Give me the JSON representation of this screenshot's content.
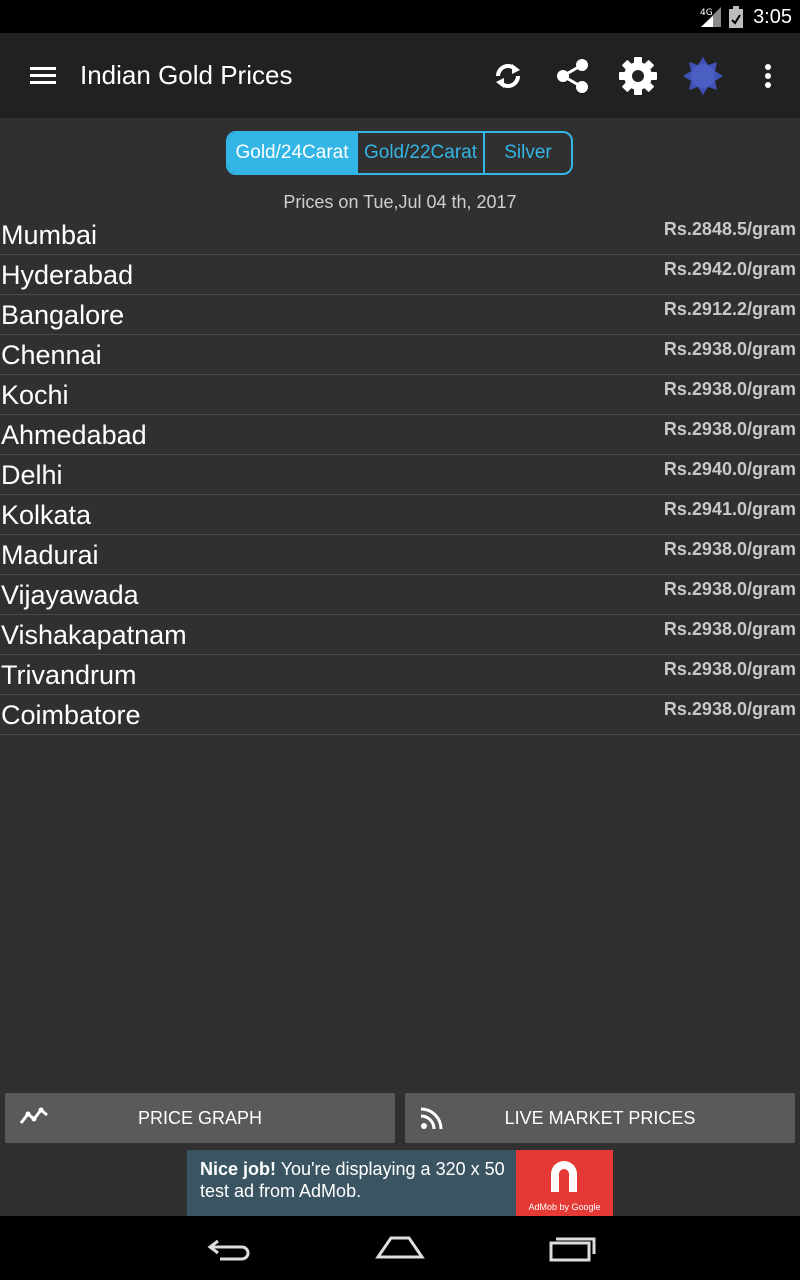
{
  "status_bar": {
    "network": "4G",
    "time": "3:05"
  },
  "app_bar": {
    "title": "Indian Gold Prices",
    "icons": [
      "menu-icon",
      "refresh-icon",
      "share-icon",
      "settings-icon",
      "badge-icon",
      "more-vert-icon"
    ],
    "badge_color": "#3f51b5"
  },
  "tabs": [
    {
      "label": "Gold/24Carat",
      "active": true
    },
    {
      "label": "Gold/22Carat",
      "active": false
    },
    {
      "label": "Silver",
      "active": false
    }
  ],
  "date_line": "Prices on Tue,Jul 04 th, 2017",
  "prices": [
    {
      "city": "Mumbai",
      "price": "Rs.2848.5/gram"
    },
    {
      "city": "Hyderabad",
      "price": "Rs.2942.0/gram"
    },
    {
      "city": "Bangalore",
      "price": "Rs.2912.2/gram"
    },
    {
      "city": "Chennai",
      "price": "Rs.2938.0/gram"
    },
    {
      "city": "Kochi",
      "price": "Rs.2938.0/gram"
    },
    {
      "city": "Ahmedabad",
      "price": "Rs.2938.0/gram"
    },
    {
      "city": "Delhi",
      "price": "Rs.2940.0/gram"
    },
    {
      "city": "Kolkata",
      "price": "Rs.2941.0/gram"
    },
    {
      "city": "Madurai",
      "price": "Rs.2938.0/gram"
    },
    {
      "city": "Vijayawada",
      "price": "Rs.2938.0/gram"
    },
    {
      "city": "Vishakapatnam",
      "price": "Rs.2938.0/gram"
    },
    {
      "city": "Trivandrum",
      "price": "Rs.2938.0/gram"
    },
    {
      "city": "Coimbatore",
      "price": "Rs.2938.0/gram"
    }
  ],
  "buttons": {
    "price_graph": "PRICE GRAPH",
    "live_market": "LIVE MARKET PRICES"
  },
  "ad": {
    "bold": "Nice job!",
    "text": " You're displaying a 320 x 50 test ad from AdMob.",
    "logo_caption": "AdMob by Google"
  },
  "colors": {
    "accent": "#33b5e5",
    "background": "#303030",
    "app_bar": "#212121"
  }
}
